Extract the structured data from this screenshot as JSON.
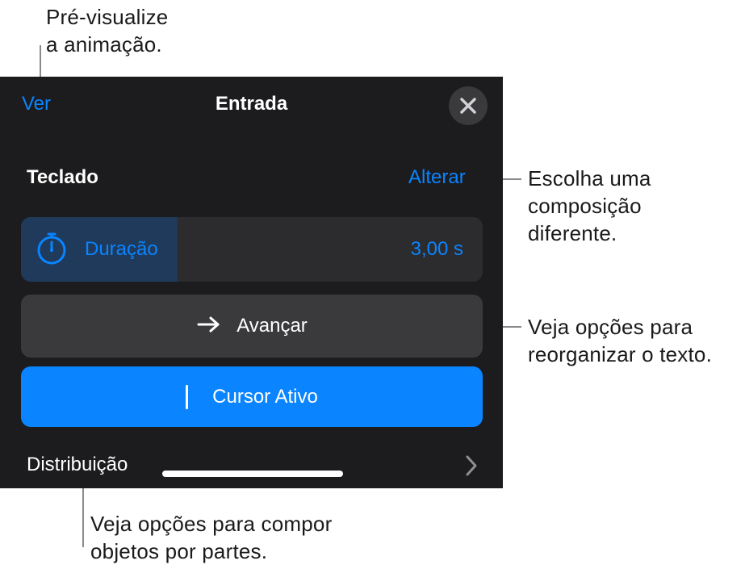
{
  "callouts": {
    "preview": "Pré-visualize\na animação.",
    "change": "Escolha uma\ncomposição\ndiferente.",
    "advance": "Veja opções para\nreorganizar o texto.",
    "delivery": "Veja opções para compor\nobjetos por partes."
  },
  "header": {
    "preview_label": "Ver",
    "title": "Entrada",
    "close_icon": "close-icon"
  },
  "section": {
    "label": "Teclado",
    "action_label": "Alterar"
  },
  "duration": {
    "icon": "stopwatch-icon",
    "label": "Duração",
    "value": "3,00 s",
    "fill_fraction": 0.34
  },
  "advance": {
    "icon": "arrow-right-icon",
    "label": "Avançar"
  },
  "cursor": {
    "label": "Cursor Ativo"
  },
  "delivery": {
    "label": "Distribuição",
    "chevron_icon": "chevron-right-icon"
  },
  "colors": {
    "panel_bg": "#1c1c1e",
    "accent": "#0a84ff",
    "control_bg": "#3a3a3c",
    "duration_bg": "#2c2c2e",
    "duration_fill": "#1f3a5a"
  }
}
